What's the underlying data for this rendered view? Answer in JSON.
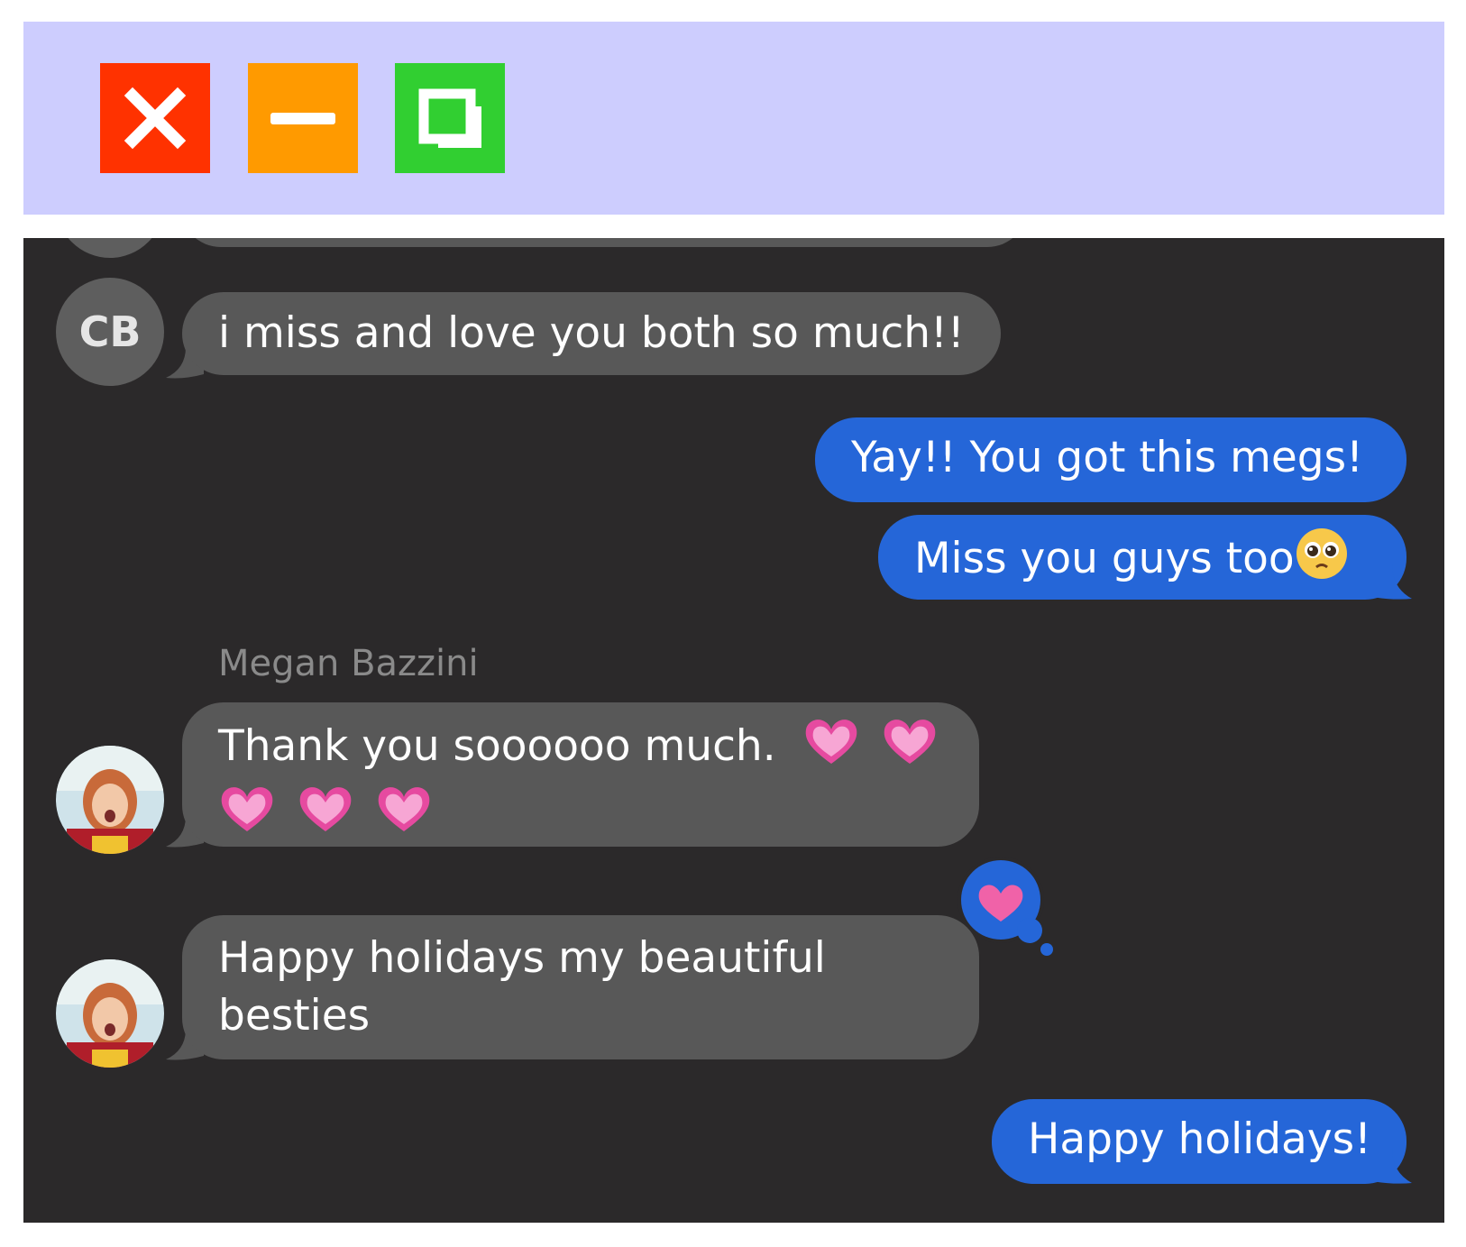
{
  "window": {
    "controls": [
      {
        "name": "close",
        "icon": "close-icon",
        "color": "#ff3200"
      },
      {
        "name": "minimize",
        "icon": "minimize-icon",
        "color": "#ff9a00"
      },
      {
        "name": "maximize",
        "icon": "restore-icon",
        "color": "#31cf31"
      }
    ],
    "titlebar_color": "#cdcdfe"
  },
  "conversation": {
    "background": "#2b292a",
    "incoming_color": "#585858",
    "outgoing_color": "#2566d8",
    "messages": [
      {
        "direction": "incoming",
        "avatar": "CB",
        "text": "i miss and love you both so much!!"
      },
      {
        "direction": "outgoing",
        "text": "Yay!! You got this megs!"
      },
      {
        "direction": "outgoing",
        "text": "Miss you guys too",
        "emoji": "pleading-face-icon"
      },
      {
        "direction": "incoming",
        "sender": "Megan Bazzini",
        "avatar": "photo",
        "text": "Thank you soooooo much.",
        "emoji": "pink-heart-icon x5"
      },
      {
        "direction": "incoming",
        "avatar": "photo",
        "text_line1": "Happy holidays my beautiful",
        "text_line2": "besties",
        "reaction": "heart-reaction-icon"
      },
      {
        "direction": "outgoing",
        "text": "Happy holidays!"
      }
    ]
  }
}
